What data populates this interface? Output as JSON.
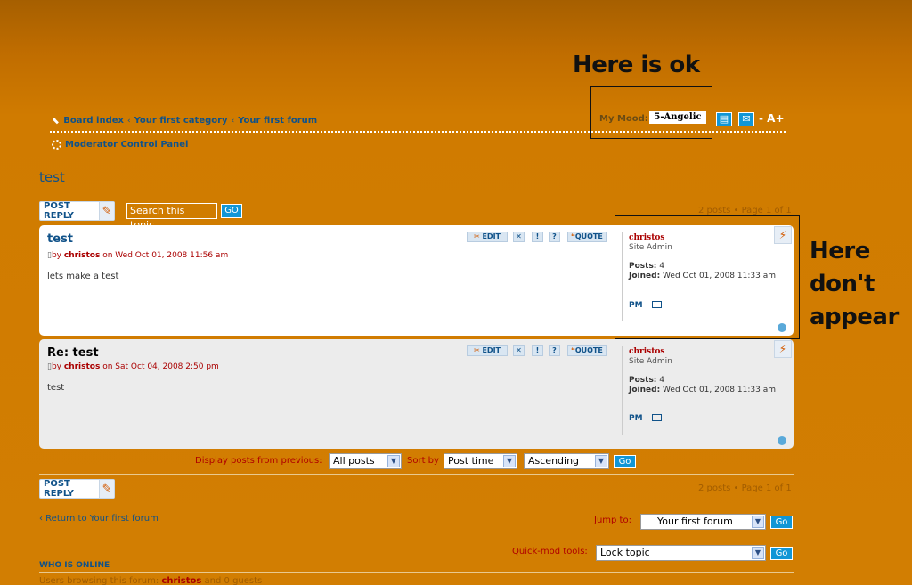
{
  "annotations": {
    "ok": "Here is ok",
    "not_appear": [
      "Here",
      "don't",
      "appear"
    ]
  },
  "breadcrumbs": {
    "board_index": "Board index",
    "category": "Your first category",
    "forum": "Your first forum",
    "separator": "‹"
  },
  "mcp_label": "Moderator Control Panel",
  "mood": {
    "label": "My Mood:",
    "value": "5-Angelic"
  },
  "fontsize_label": "- A+",
  "topic_title": "test",
  "post_reply_label": "POST REPLY",
  "search": {
    "placeholder": "Search this topic…",
    "go": "GO"
  },
  "pagination": "2 posts • Page 1 of 1",
  "post_buttons": {
    "edit": "EDIT",
    "delete": "✕",
    "report": "!",
    "info": "?",
    "quote": "QUOTE"
  },
  "posts": [
    {
      "title": "test",
      "by": "by",
      "author": "christos",
      "date": "on Wed Oct 01, 2008 11:56 am",
      "body": "lets make a test",
      "profile": {
        "name": "christos",
        "rank": "Site Admin",
        "posts_label": "Posts:",
        "posts": "4",
        "joined_label": "Joined:",
        "joined": "Wed Oct 01, 2008 11:33 am",
        "pm": "PM"
      }
    },
    {
      "title": "Re: test",
      "by": "by",
      "author": "christos",
      "date": "on Sat Oct 04, 2008 2:50 pm",
      "body": "test",
      "profile": {
        "name": "christos",
        "rank": "Site Admin",
        "posts_label": "Posts:",
        "posts": "4",
        "joined_label": "Joined:",
        "joined": "Wed Oct 01, 2008 11:33 am",
        "pm": "PM"
      }
    }
  ],
  "display_controls": {
    "display_label": "Display posts from previous:",
    "display_value": "All posts",
    "sort_label": "Sort by",
    "sort_value": "Post time",
    "order_value": "Ascending",
    "go": "Go"
  },
  "return_link": "‹ Return to Your first forum",
  "jump_to": {
    "label": "Jump to:",
    "value": "Your first forum",
    "go": "Go"
  },
  "quickmod": {
    "label": "Quick-mod tools:",
    "value": "Lock topic",
    "go": "Go"
  },
  "who_is_online": {
    "heading": "WHO IS ONLINE",
    "text_prefix": "Users browsing this forum:",
    "user": "christos",
    "text_suffix": "and 0 guests"
  },
  "colors": {
    "background": "#d07b00",
    "link": "#105289",
    "author": "#aa0000",
    "button": "#1196d6"
  }
}
